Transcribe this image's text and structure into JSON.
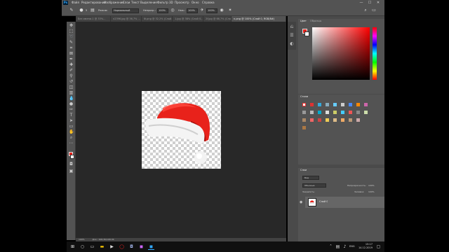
{
  "colors": {
    "accent": "#31a8ff",
    "hat_red": "#e8221b",
    "panel_bg": "#535353",
    "canvas_bg": "#282828"
  },
  "app": {
    "logo": "Ps"
  },
  "menu": [
    "Файл",
    "Редактирование",
    "Изображение",
    "Слои",
    "Текст",
    "Выделение",
    "Фильтр",
    "3D",
    "Просмотр",
    "Окно",
    "Справка"
  ],
  "window_controls": {
    "minimize": "—",
    "maximize": "☐",
    "close": "✕"
  },
  "options": {
    "size_value": "5",
    "mode_label": "Режим:",
    "mode_value": "Нормальный",
    "opacity_label": "Непрозр.:",
    "opacity_value": "100%",
    "flow_label": "Наж.:",
    "flow_value": "100%",
    "hardness_value": "100%"
  },
  "tabs": [
    "Без имени-1 @ 33%...",
    "n2396.jpg @ 36,7% ...",
    "Ф.png @ 32,2% (Слой...",
    "1.jpg @ 38% (Слой 0...",
    "2f.jpg @ 66,7% (Сло...",
    "n.png @ 100% (Слой 0, RGB/8#)"
  ],
  "status": {
    "zoom": "100%",
    "doc": "Док.: 108,3K/108,3K"
  },
  "color_panel": {
    "tab_active": "Цвет",
    "tab_inactive": "Образцы"
  },
  "swatch_panel": {
    "title": "Стили"
  },
  "layers_panel": {
    "title": "Слои",
    "filter_label": "Вид",
    "blend_mode": "Обычные",
    "opacity_label": "Непрозрачность:",
    "opacity_value": "100%",
    "lock_label": "Закрепить:",
    "fill_label": "Заливка:",
    "fill_value": "100%",
    "layer_name": "Слой 0"
  },
  "taskbar": {
    "language": "ENG",
    "time": "15:17",
    "date": "14.12.2019"
  }
}
